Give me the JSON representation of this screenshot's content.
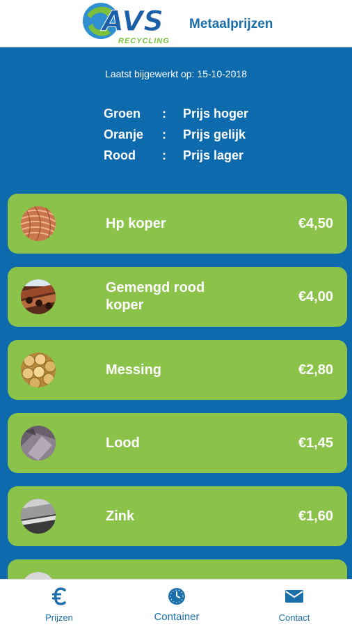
{
  "header": {
    "logo_text": "AVS",
    "logo_subtext": "RECYCLING",
    "title": "Metaalprijzen"
  },
  "updated_text": "Laatst bijgewerkt op: 15-10-2018",
  "legend": [
    {
      "color": "Groen",
      "sep": ":",
      "meaning": "Prijs hoger"
    },
    {
      "color": "Oranje",
      "sep": ":",
      "meaning": "Prijs gelijk"
    },
    {
      "color": "Rood",
      "sep": ":",
      "meaning": "Prijs lager"
    }
  ],
  "items": [
    {
      "name": "Hp koper",
      "price": "€4,50",
      "icon": "copper-wire-thumbnail"
    },
    {
      "name": "Gemengd rood koper",
      "price": "€4,00",
      "icon": "copper-pipes-thumbnail"
    },
    {
      "name": "Messing",
      "price": "€2,80",
      "icon": "brass-rods-thumbnail"
    },
    {
      "name": "Lood",
      "price": "€1,45",
      "icon": "lead-thumbnail"
    },
    {
      "name": "Zink",
      "price": "€1,60",
      "icon": "zinc-thumbnail"
    },
    {
      "name": "",
      "price": "",
      "icon": "metal-thumbnail"
    }
  ],
  "nav": [
    {
      "label": "Prijzen",
      "icon": "euro-icon"
    },
    {
      "label": "Container",
      "icon": "clock-icon"
    },
    {
      "label": "Contact",
      "icon": "mail-icon"
    }
  ],
  "colors": {
    "primary_blue": "#0c6aad",
    "card_green": "#8bc34a",
    "text_blue": "#1a6eaa",
    "white": "#ffffff"
  }
}
